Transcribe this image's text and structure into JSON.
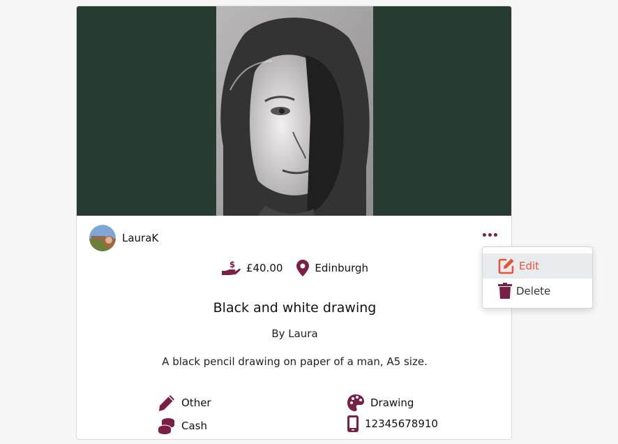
{
  "post": {
    "owner": "LauraK",
    "price": "£40.00",
    "location": "Edinburgh",
    "title": "Black and white drawing",
    "byline": "By Laura",
    "description": "A black pencil drawing on paper of a man, A5 size.",
    "category": "Other",
    "medium": "Drawing",
    "payment": "Cash",
    "phone": "12345678910"
  },
  "menu": {
    "edit_label": "Edit",
    "delete_label": "Delete"
  },
  "colors": {
    "accent": "#7a1f46",
    "edit": "#e8513a",
    "hero_bg": "#263c30"
  },
  "icons": {
    "price": "hand-holding-dollar-icon",
    "location": "map-pin-icon",
    "category": "pencil-icon",
    "medium": "palette-icon",
    "payment": "coins-icon",
    "phone": "mobile-phone-icon",
    "more": "ellipsis-icon",
    "edit": "edit-icon",
    "delete": "trash-icon"
  }
}
